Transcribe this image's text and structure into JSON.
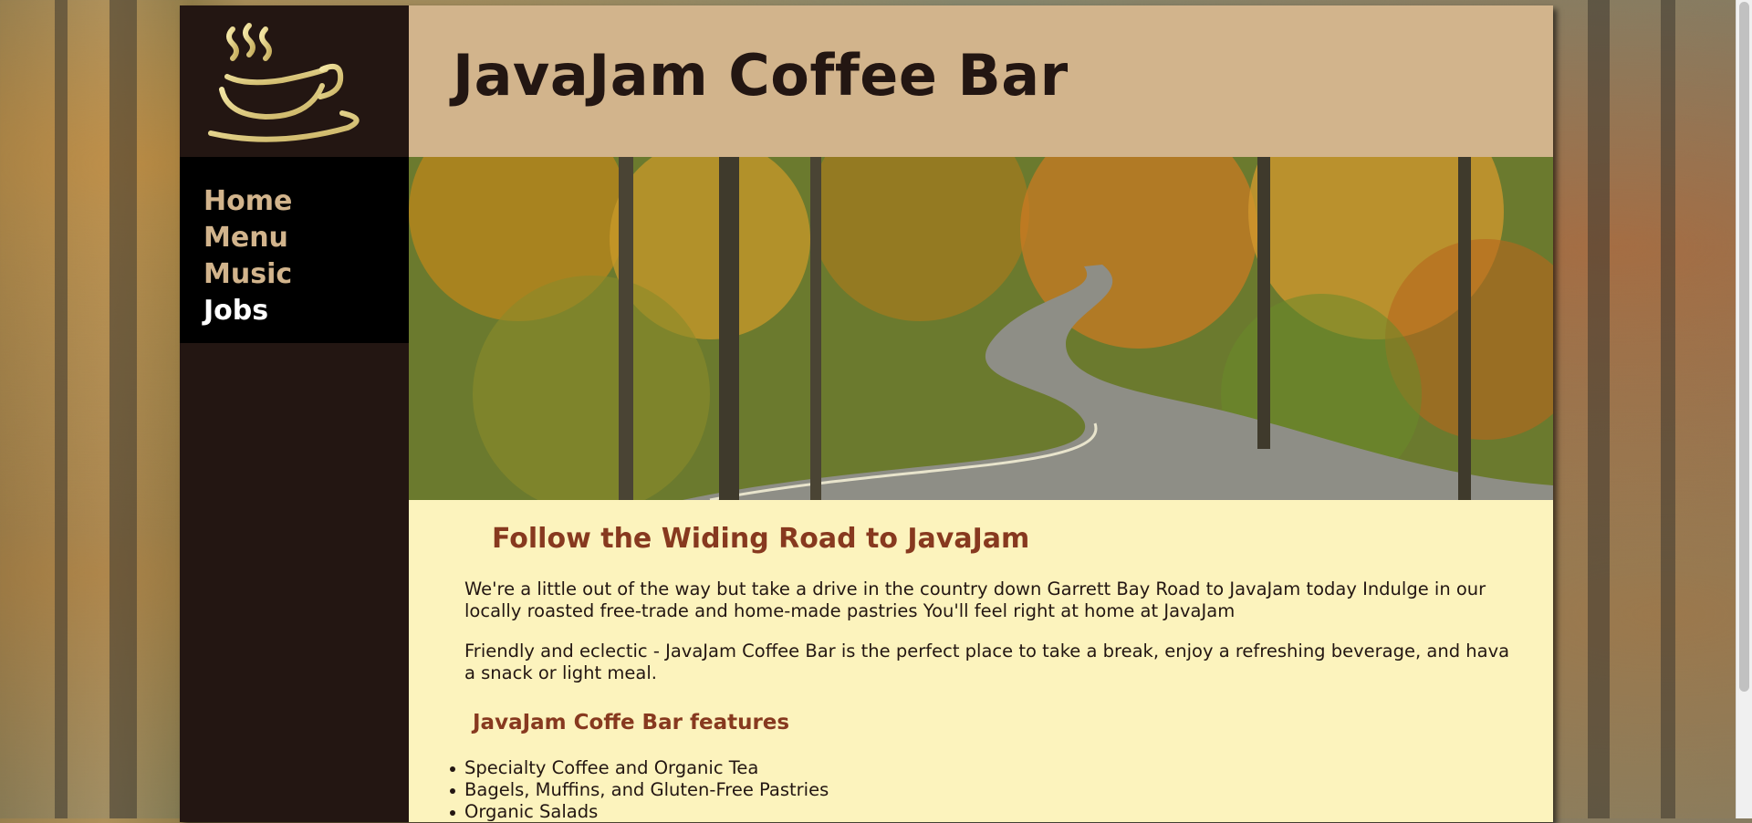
{
  "site": {
    "title": "JavaJam Coffee Bar"
  },
  "logo": {
    "icon": "steaming-coffee-cup-icon"
  },
  "nav": {
    "items": [
      {
        "label": "Home",
        "active": false
      },
      {
        "label": "Menu",
        "active": false
      },
      {
        "label": "Music",
        "active": false
      },
      {
        "label": "Jobs",
        "active": true
      }
    ]
  },
  "hero": {
    "image": "winding-road-autumn-forest"
  },
  "content": {
    "heading": "Follow the Widing Road to JavaJam",
    "paragraph1": "We're a little out of the way but take a drive in the country down Garrett Bay Road to JavaJam today Indulge in our locally roasted free-trade and home-made pastries You'll feel right at home at JavaJam",
    "paragraph2": "Friendly and eclectic - JavaJam Coffee Bar is the perfect place to take a break, enjoy a refreshing beverage, and hava a snack or light meal.",
    "features_heading": "JavaJam Coffe Bar features",
    "features": [
      "Specialty Coffee and Organic Tea",
      "Bagels, Muffins, and Gluten-Free Pastries",
      "Organic Salads"
    ]
  },
  "colors": {
    "dark_brown": "#231612",
    "tan": "#d2b48c",
    "cream": "#fcf3bd",
    "rust": "#87391f"
  }
}
